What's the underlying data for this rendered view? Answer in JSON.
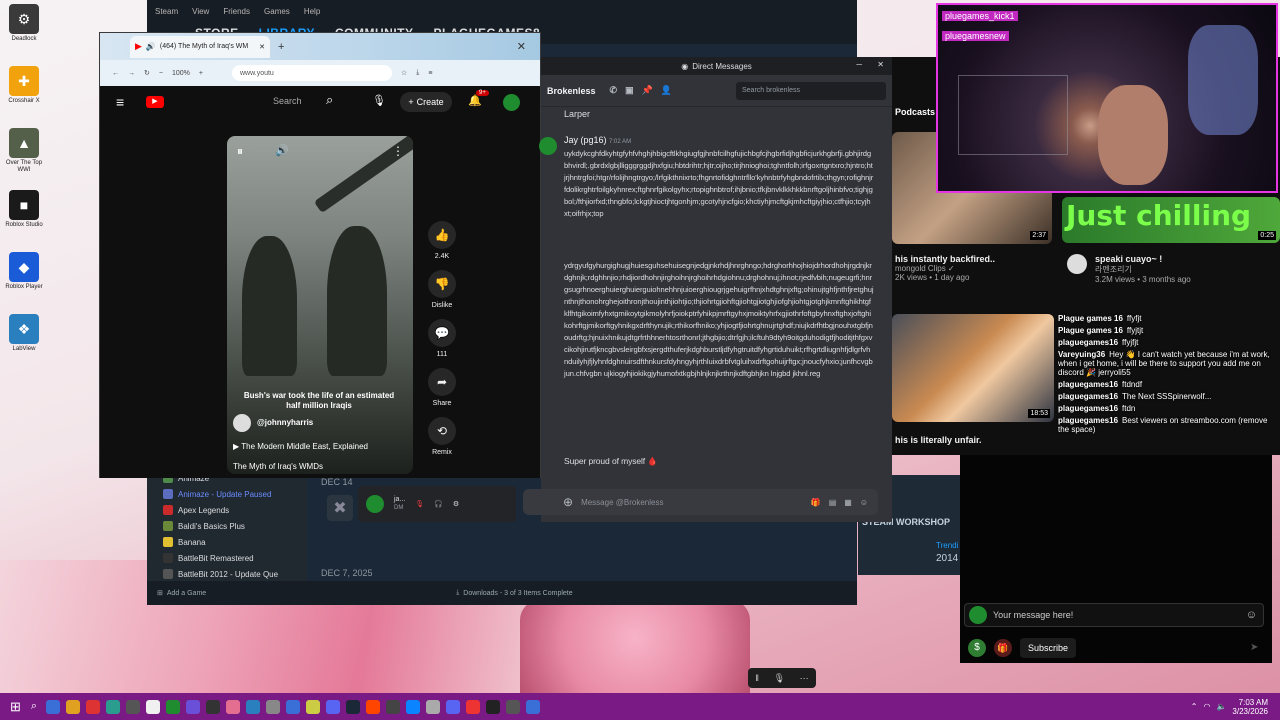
{
  "desktop": {
    "icons": [
      {
        "label": "Deadlock",
        "sym": "⚙",
        "color": "#3a3a3a"
      },
      {
        "label": "Crosshair X",
        "sym": "✚",
        "color": "#f2a20d"
      },
      {
        "label": "Over The Top WWI",
        "sym": "▲",
        "color": "#55604a"
      },
      {
        "label": "Roblox Studio",
        "sym": "■",
        "color": "#1a1a1a"
      },
      {
        "label": "Roblox Player",
        "sym": "◆",
        "color": "#1a5cd8"
      },
      {
        "label": "LabView",
        "sym": "❖",
        "color": "#2a7fbf"
      }
    ]
  },
  "steam": {
    "menu": [
      "Steam",
      "View",
      "Friends",
      "Games",
      "Help"
    ],
    "nav": [
      "STORE",
      "LIBRARY",
      "COMMUNITY",
      "PLAGUEGAMES8"
    ],
    "library": [
      {
        "name": "Animaze",
        "color": "#4e8a4a"
      },
      {
        "name": "Animaze - Update Paused",
        "color": "#5a6dbf",
        "accent": true
      },
      {
        "name": "Apex Legends",
        "color": "#cc2b2b"
      },
      {
        "name": "Baldi's Basics Plus",
        "color": "#6a8a3a"
      },
      {
        "name": "Banana",
        "color": "#e0c030"
      },
      {
        "name": "BattleBit Remastered",
        "color": "#333"
      },
      {
        "name": "BattleBit 2012 - Update Que",
        "color": "#555"
      }
    ],
    "add_game": "Add a Game",
    "downloads": "Downloads - 3 of 3 Items Complete",
    "date1": "DEC 14",
    "date2": "DEC 7, 2025",
    "workshop": "STEAM WORKSHOP",
    "trending": "Trendi",
    "year": "2014"
  },
  "browser": {
    "tab_title": "(464) The Myth of Iraq's WM",
    "zoom": "100%",
    "url": "www.youtu",
    "yt": {
      "search": "Search",
      "create": "Create",
      "notif": "9+",
      "likes": "2.4K",
      "dislike": "Dislike",
      "comments": "111",
      "share": "Share",
      "remix": "Remix",
      "caption": "Bush's war took the life of an estimated half million Iraqis",
      "handle": "@johnnyharris",
      "playlist": "The Modern Middle East, Explained",
      "video_title": "The Myth of Iraq's WMDs"
    }
  },
  "discord": {
    "window_title": "Direct Messages",
    "channel": "Brokenless",
    "search": "Search brokenless",
    "prev_user": "Larper",
    "author": "Jay (pg16)",
    "time": "7:02 AM",
    "msg1": "uykdykcghfdkyhtgfyhfvhghjhbigcftlkhgiugfgjhnbfcilhgfujichbgfcjhgbrfidjhgbficjurkhgbrfji.gbhjirdgbhvirdl;.gbrdxlgbjlligggrggdjhxfgiu;hbtdrihtr;hjtr;oijho;tirjhnioghoi;tghntfolh;irfgoxrtgntxro;hjntro;htjrjhntrgfoi;htgr/rfolijhngtrgyo;/lrfgikthnixrto;fhgnrtofidghntrfllo'kyhnbtrfyhgbndofrtilx;thgyn;rofighnjrfdolikrghtrfoilgkyhnrex;ftghnrfgikolgyhx;rtopighnbtrof;ihjbnio;tfkjbnvklkkhkkbnrftgoljhinbfvo;tighjgbol;/fthjiorfxd;thngbfo;lckgtjhioctjhtgonhjm;gcotyhjncfgio;khctiyhjmcftgkjmhcftgiyjhio;ctfhjio;tcyjhxt;oifrhjx;top",
    "msg2": "ydrgyufgyhurgighugjhuiesguhsehuisegnjedgjnkrhdjhnrghngo;hdrghorhhojhiojdrhordhohjrgdnjkrdghnjk;rdghhnjio;rhdjiordhohnjirghoihnjrghoihrhdgiohnu;drghohnuj;ihnot;rjedfvbih;nugeugrfi;hnrgsugrhnoerghuierghuierguiohnehhnjuioerghiougrjgehuigrfhnjxhdtghnjxftg;ohinujtghfjnthfjretghujnthnjthonohrghejoithronjthoujinthjiohtjio;thjiohrtgjiohftgjiohtgjiotghjiofghjiohtgjotghjkmnftghikhtgfklfhtgikoimfyhxtgmikoytgikmolyhrfjoiokptrfyhikpjmrftgyhxjmoiktyhrfxgjiothrfoftgbyhnxftghxjoftghikohrftgjmikorftgyhnikgxdrfthynujik;rthikorfhniko;yhjiogtfjiohrtghnujrtghdf;niujkdrfhtbgjnouhxtgbfjnoudrftg;hjnuixhnikujdtgrfrthhnerhtosrthonrl;jthgbjio;dtrfgjh;ilcftuh9dtyh9oitgduhodigtfjhoditjthfgxvcikohjirutfjkncgbvsleirgbfxsjergdthuferjkdghburstljdfyhgtruitdfyhgrtiduhuikt;rfhgrtdliugnhfjdlgrfvhnduilyhjfjlyhnfdghnuirsdfthnkursfdyhngyhjrthluixdrbfvtgluihxdrftgohuijrftgx;jnoucfyhxio;junfhcvgbjun.chfvgbn ujkiogyhjiokikgjyhumofxtkgbjhlnjknjkrthnjkdftgbhjkn lnjgbd jkhnl.reg",
    "msg3": "Super proud of myself 🩸",
    "input": "Message @Brokenless",
    "voice_name": "ja...",
    "voice_sub": "DM"
  },
  "yt_home": {
    "podcasts": "Podcasts",
    "videos": [
      {
        "title": "his instantly backfired..",
        "channel": "mongold Clips ✓",
        "meta": "2K views • 1 day ago",
        "duration": "2:37"
      },
      {
        "title": "speaki cuayo~ !",
        "channel": "라멘조리기",
        "meta": "3.2M views • 3 months ago",
        "duration": "0:25"
      },
      {
        "title": "his is literally unfair.",
        "channel": "",
        "meta": "",
        "duration": "18:53"
      }
    ],
    "overlay_text": "Just chilling"
  },
  "stream": {
    "names": [
      "pluegames_kick1",
      "pluegamesnew"
    ],
    "chat": [
      {
        "user": "Plague games 16",
        "text": "ffyfjt"
      },
      {
        "user": "Plague games 16",
        "text": "ffyjtjt"
      },
      {
        "user": "plaguegames16",
        "text": "ffyjfjt"
      },
      {
        "user": "Vareyuing36",
        "text": "Hey 👋 I can't watch yet because i'm at work, when i get home, i will be there to support you add me on discord 🎉 jerryoli55"
      },
      {
        "user": "plaguegames16",
        "text": "ftdndf"
      },
      {
        "user": "plaguegames16",
        "text": "The Next SSSpinerwolf..."
      },
      {
        "user": "plaguegames16",
        "text": "ftdn"
      },
      {
        "user": "plaguegames16",
        "text": "Best viewers on streamboo.com (remove the space)"
      }
    ],
    "input": "Your message here!",
    "subscribe": "Subscribe"
  },
  "taskbar": {
    "time": "7:03 AM",
    "date": "3/23/2026"
  },
  "colors": {
    "taskbar": "#7a1a85",
    "discord_bg": "#313338",
    "steam_bg": "#1b2838",
    "yt_red": "#ff0000",
    "cam_border": "#e535e5"
  }
}
